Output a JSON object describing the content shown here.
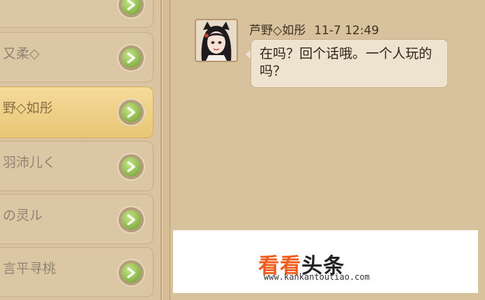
{
  "contacts": [
    {
      "name": ""
    },
    {
      "name": "又柔◇"
    },
    {
      "name": "野◇如彤"
    },
    {
      "name": "羽沛儿く"
    },
    {
      "name": "の灵ル"
    },
    {
      "name": "言平寻桃"
    }
  ],
  "selected_index": 2,
  "chat": {
    "sender": "芦野◇如彤",
    "time": "11-7 12:49",
    "message": "在吗？回个话哦。一个人玩的吗？"
  },
  "watermark": {
    "brand_orange": "看看",
    "brand_black": "头条",
    "url": "www.kankantoutiao.com"
  },
  "colors": {
    "panel": "#d8c29d",
    "selected_row": "#e9c676",
    "go_button": "#6a9c2c",
    "brand_orange": "#f05a1a"
  }
}
